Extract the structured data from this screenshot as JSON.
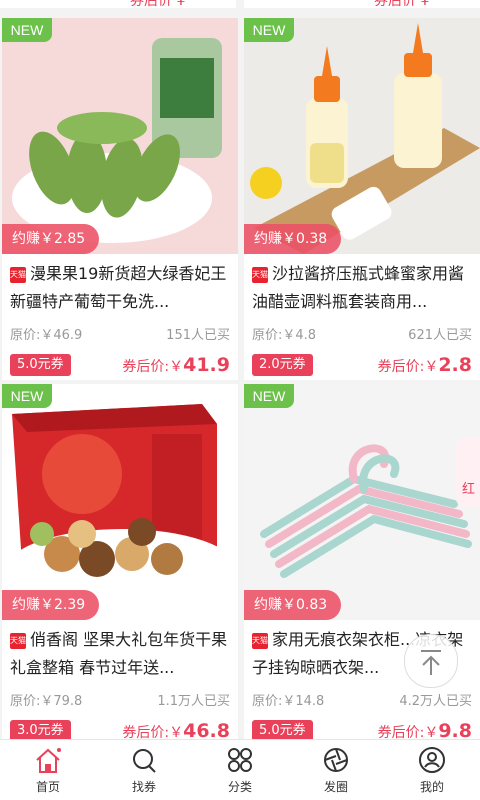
{
  "top_strip": {
    "left": "券后价 ¥",
    "right": "券后价 ¥"
  },
  "products": [
    {
      "badge": "NEW",
      "earn": "约赚￥2.85",
      "title": "漫果果19新货超大绿香妃王新疆特产葡萄干免洗...",
      "original": "原价:￥46.9",
      "sold": "151人已买",
      "coupon": "5.0元券",
      "after_label": "券后价:￥",
      "after_price": "41.9"
    },
    {
      "badge": "NEW",
      "earn": "约赚￥0.38",
      "title": "沙拉酱挤压瓶式蜂蜜家用酱油醋壶调料瓶套装商用...",
      "original": "原价:￥4.8",
      "sold": "621人已买",
      "coupon": "2.0元券",
      "after_label": "券后价:￥",
      "after_price": "2.8"
    },
    {
      "badge": "NEW",
      "earn": "约赚￥2.39",
      "title": "俏香阁 坚果大礼包年货干果礼盒整箱 春节过年送...",
      "original": "原价:￥79.8",
      "sold": "1.1万人已买",
      "coupon": "3.0元券",
      "after_label": "券后价:￥",
      "after_price": "46.8"
    },
    {
      "badge": "NEW",
      "earn": "约赚￥0.83",
      "title": "家用无痕衣架衣柜...凉衣架子挂钩晾晒衣架...",
      "original": "原价:￥14.8",
      "sold": "4.2万人已买",
      "coupon": "5.0元券",
      "after_label": "券后价:￥",
      "after_price": "9.8"
    }
  ],
  "tmall_badge": "天猫",
  "side_tab": "红",
  "tabs": [
    {
      "label": "首页",
      "icon": "home-icon"
    },
    {
      "label": "找券",
      "icon": "search-icon"
    },
    {
      "label": "分类",
      "icon": "category-icon"
    },
    {
      "label": "发圈",
      "icon": "aperture-icon"
    },
    {
      "label": "我的",
      "icon": "user-icon"
    }
  ],
  "colors": {
    "accent": "#e9415a",
    "new_badge": "#6cc14a"
  }
}
